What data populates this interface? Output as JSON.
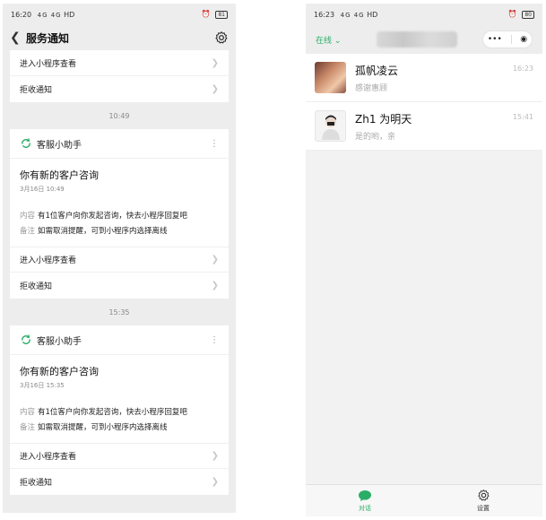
{
  "left": {
    "status": {
      "time": "16:20",
      "signal": "4G 4G",
      "wifi": "HD",
      "battery": "81"
    },
    "nav": {
      "title": "服务通知"
    },
    "top_actions": {
      "view": "进入小程序查看",
      "reject": "拒收通知"
    },
    "cards": [
      {
        "time": "10:49",
        "sender": "客服小助手",
        "title": "你有新的客户咨询",
        "date": "3月16日  10:49",
        "content_label": "内容",
        "content": "有1位客户向你发起咨询，快去小程序回复吧",
        "note_label": "备注",
        "note": "如需取消提醒，可到小程序内选择离线",
        "view": "进入小程序查看",
        "reject": "拒收通知"
      },
      {
        "time": "15:35",
        "sender": "客服小助手",
        "title": "你有新的客户咨询",
        "date": "3月16日  15:35",
        "content_label": "内容",
        "content": "有1位客户向你发起咨询，快去小程序回复吧",
        "note_label": "备注",
        "note": "如需取消提醒，可到小程序内选择离线",
        "view": "进入小程序查看",
        "reject": "拒收通知"
      }
    ]
  },
  "right": {
    "status": {
      "time": "16:23",
      "signal": "4G 4G",
      "wifi": "HD",
      "battery": "80"
    },
    "nav": {
      "status": "在线"
    },
    "chats": [
      {
        "name": "孤帆凌云",
        "message": "感谢惠顾",
        "time": "16:23"
      },
      {
        "name": "Zh1 为明天",
        "message": "是的哟，亲",
        "time": "15:41"
      }
    ],
    "tabs": [
      {
        "label": "对话",
        "icon": "chat-bubble-icon"
      },
      {
        "label": "设置",
        "icon": "gear-icon"
      }
    ]
  },
  "colors": {
    "accent": "#2aae67",
    "background": "#ededed"
  }
}
